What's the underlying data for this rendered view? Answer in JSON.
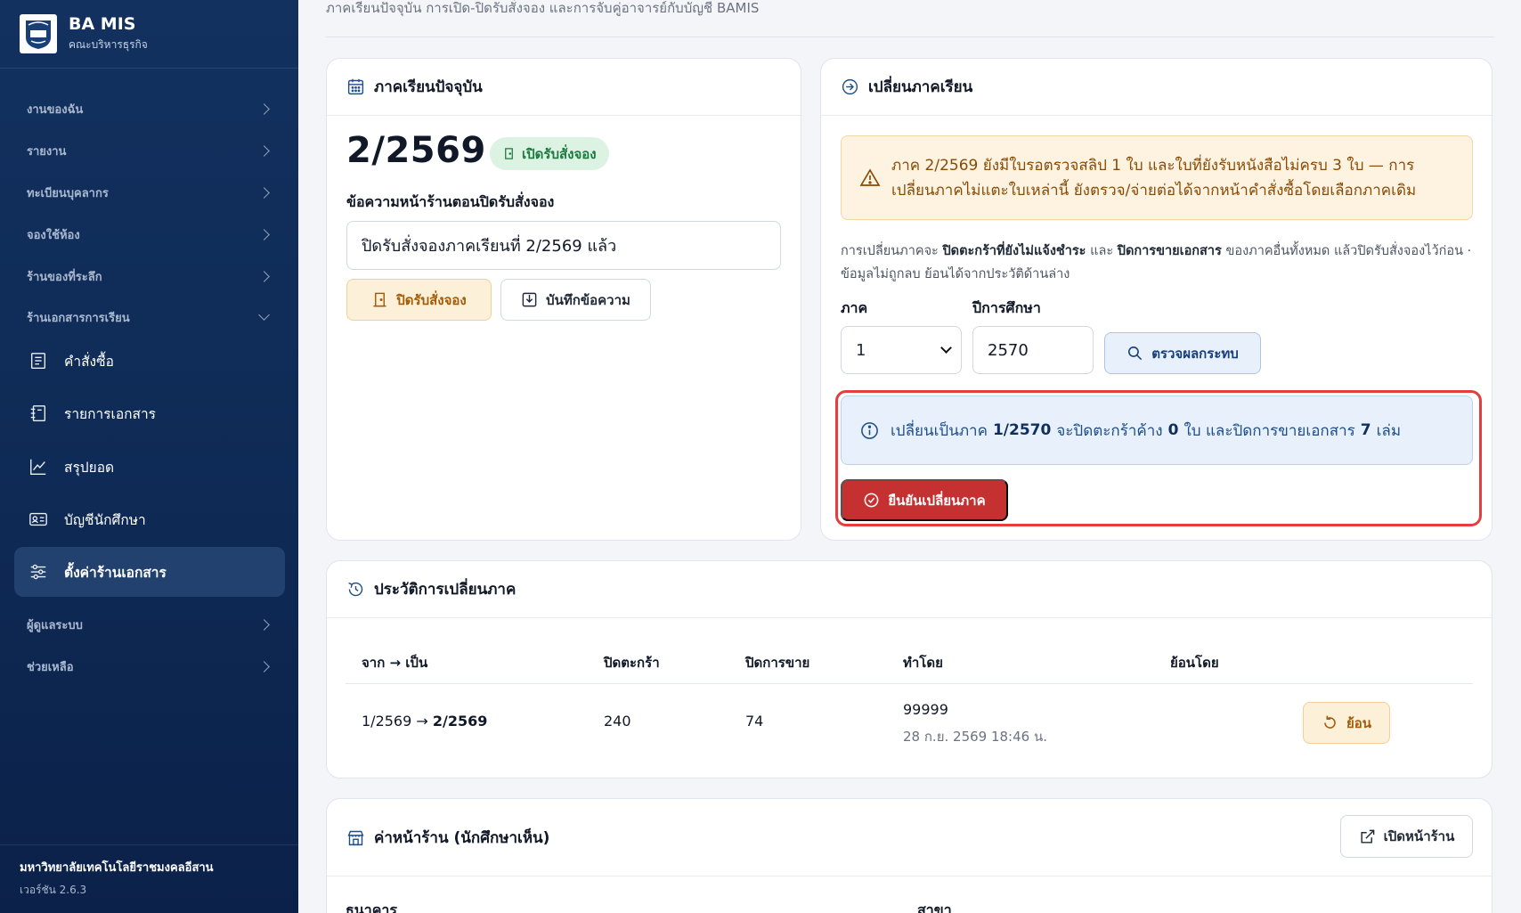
{
  "sidebar": {
    "brand_title": "BA MIS",
    "brand_sub": "คณะบริหารธุรกิจ",
    "groups": [
      {
        "label": "งานของฉัน"
      },
      {
        "label": "รายงาน"
      },
      {
        "label": "ทะเบียนบุคลากร"
      },
      {
        "label": "จองใช้ห้อง"
      },
      {
        "label": "ร้านของที่ระลึก"
      },
      {
        "label": "ร้านเอกสารการเรียน"
      }
    ],
    "items": [
      {
        "label": "คำสั่งซื้อ",
        "icon": "receipt-icon"
      },
      {
        "label": "รายการเอกสาร",
        "icon": "book-icon"
      },
      {
        "label": "สรุปยอด",
        "icon": "chart-line-icon"
      },
      {
        "label": "บัญชีนักศึกษา",
        "icon": "id-card-icon"
      },
      {
        "label": "ตั้งค่าร้านเอกสาร",
        "icon": "sliders-icon",
        "active": true
      }
    ],
    "groups_after": [
      {
        "label": "ผู้ดูแลระบบ"
      },
      {
        "label": "ช่วยเหลือ"
      }
    ],
    "footer_org": "มหาวิทยาลัยเทคโนโลยีราชมงคลอีสาน",
    "footer_version": "เวอร์ชัน 2.6.3"
  },
  "page": {
    "description": "ภาคเรียนปัจจุบัน การเปิด-ปิดรับสั่งจอง และการจับคู่อาจารย์กับบัญชี BAMIS"
  },
  "current_term": {
    "title": "ภาคเรียนปัจจุบัน",
    "term": "2/2569",
    "status_badge": "เปิดรับสั่งจอง",
    "message_label": "ข้อความหน้าร้านตอนปิดรับสั่งจอง",
    "message_value": "ปิดรับสั่งจองภาคเรียนที่ 2/2569 แล้ว",
    "close_button": "ปิดรับสั่งจอง",
    "save_button": "บันทึกข้อความ"
  },
  "change_term": {
    "title": "เปลี่ยนภาคเรียน",
    "warning_line1": "ภาค 2/2569 ยังมีใบรอตรวจสลิป 1 ใบ และใบที่ยังรับหนังสือไม่ครบ 3 ใบ — การ",
    "warning_line2": "เปลี่ยนภาคไม่แตะใบเหล่านี้ ยังตรวจ/จ่ายต่อได้จากหน้าคำสั่งซื้อโดยเลือกภาคเดิม",
    "explain_prefix": "การเปลี่ยนภาคจะ ",
    "explain_b1": "ปิดตะกร้าที่ยังไม่แจ้งชำระ",
    "explain_mid": " และ ",
    "explain_b2": "ปิดการขายเอกสาร",
    "explain_suffix": " ของภาคอื่นทั้งหมด แล้วปิดรับสั่งจองไว้ก่อน · ข้อมูลไม่ถูกลบ ย้อนได้จากประวัติด้านล่าง",
    "term_label": "ภาค",
    "term_value": "1",
    "year_label": "ปีการศึกษา",
    "year_value": "2570",
    "check_button": "ตรวจผลกระทบ",
    "info_prefix": "เปลี่ยนเป็นภาค",
    "info_term": "1/2570",
    "info_mid1": "จะปิดตะกร้าค้าง",
    "info_carts": "0",
    "info_mid2": "ใบ และปิดการขายเอกสาร",
    "info_docs": "7",
    "info_suffix": "เล่ม",
    "confirm_button": "ยืนยันเปลี่ยนภาค"
  },
  "history": {
    "title": "ประวัติการเปลี่ยนภาค",
    "columns": [
      "จาก → เป็น",
      "ปิดตะกร้า",
      "ปิดการขาย",
      "ทำโดย",
      "ย้อนโดย"
    ],
    "rows": [
      {
        "from": "1/2569 → ",
        "to": "2/2569",
        "carts_closed": "240",
        "sales_closed": "74",
        "by": "99999",
        "when": "28 ก.ย. 2569 18:46 น.",
        "undo_label": "ย้อน"
      }
    ]
  },
  "storefront": {
    "title": "ค่าหน้าร้าน (นักศึกษาเห็น)",
    "open_button": "เปิดหน้าร้าน",
    "col_bank": "ธนาคาร",
    "col_branch": "สาขา"
  },
  "colors": {
    "sidebar_bg": "#13315f",
    "accent_blue": "#1d4e89",
    "danger": "#c53030",
    "warning": "#a25c07",
    "success": "#1b7a3d",
    "highlight_border": "#e53e3e"
  }
}
